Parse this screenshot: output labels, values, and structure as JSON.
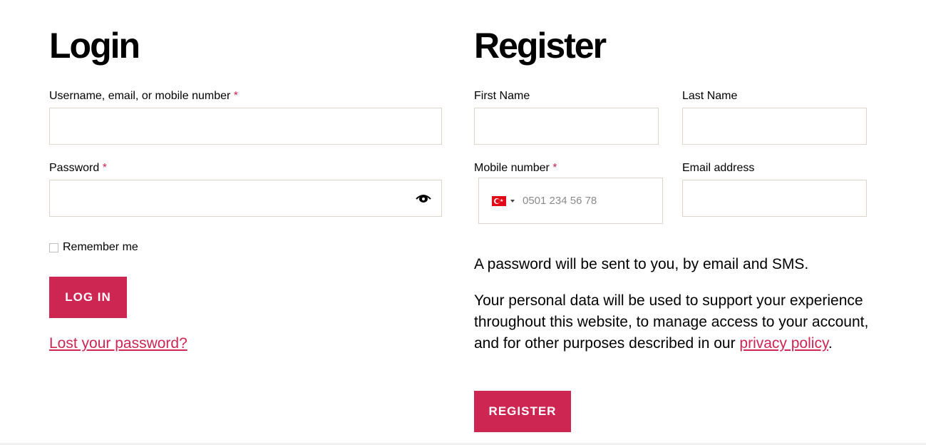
{
  "login": {
    "heading": "Login",
    "username_label": "Username, email, or mobile number",
    "required_mark": "*",
    "password_label": "Password",
    "remember_label": "Remember me",
    "login_button": "Log in",
    "lost_password": "Lost your password?"
  },
  "register": {
    "heading": "Register",
    "first_name_label": "First Name",
    "last_name_label": "Last Name",
    "mobile_label": "Mobile number",
    "email_label": "Email address",
    "phone_placeholder": "0501 234 56 78",
    "country_flag": "Turkey",
    "password_note": "A password will be sent to you, by email and SMS.",
    "privacy_text": "Your personal data will be used to support your experience throughout this website, to manage access to your account, and for other purposes described in our",
    "privacy_link": "privacy policy",
    "privacy_period": ".",
    "register_button": "Register"
  },
  "colors": {
    "accent": "#cd2653",
    "border": "#dcd7ca"
  },
  "icons": {
    "password_toggle": "eye-icon",
    "country_flag": "turkey-flag-icon",
    "dropdown": "caret-down-icon"
  }
}
